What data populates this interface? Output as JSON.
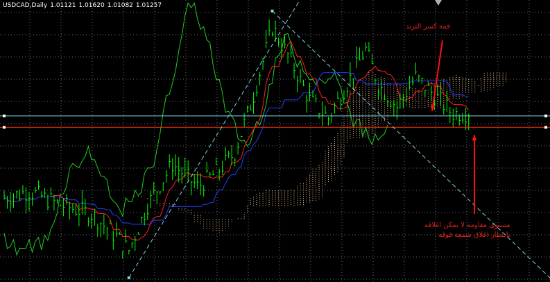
{
  "header": {
    "symbol": "USDCAD,Daily",
    "open": "1.01121",
    "high": "1.01620",
    "low": "1.01082",
    "close": "1.01257"
  },
  "annotations": {
    "trend_break": "قمة كسر الترند",
    "resistance_line1": "مستوى مقاومة لا يمكن اغلاقه",
    "resistance_line2": "بانتظار اغلاق شمعة فوقه"
  },
  "colors": {
    "background": "#000000",
    "grid": "#6b6b6b",
    "candles": "#00ff00",
    "chikou_span": "#22cc22",
    "tenkan_sen": "#ff2020",
    "kijun_sen": "#2040ff",
    "cloud": "#ffcc99",
    "trendline": "#7fd4e0",
    "horizontal_level": "#ff3300",
    "arrow": "#ff1010"
  },
  "chart_data": {
    "type": "candlestick",
    "symbol": "USDCAD",
    "timeframe": "Daily",
    "ohlc_last": {
      "open": 1.01121,
      "high": 1.0162,
      "low": 1.01082,
      "close": 1.01257
    },
    "indicators": [
      "ichimoku"
    ],
    "grid": true,
    "ylim": [
      0.94,
      1.06
    ],
    "x_count": 150,
    "price_path": [
      [
        0,
        0.975
      ],
      [
        8,
        0.978
      ],
      [
        18,
        0.972
      ],
      [
        28,
        0.968
      ],
      [
        36,
        0.958
      ],
      [
        40,
        0.952
      ],
      [
        46,
        0.972
      ],
      [
        54,
        0.99
      ],
      [
        62,
        0.98
      ],
      [
        68,
        0.986
      ],
      [
        74,
        0.995
      ],
      [
        80,
        1.02
      ],
      [
        86,
        1.05
      ],
      [
        92,
        1.035
      ],
      [
        98,
        1.018
      ],
      [
        104,
        1.01
      ],
      [
        110,
        1.025
      ],
      [
        116,
        1.04
      ],
      [
        120,
        1.025
      ],
      [
        126,
        1.015
      ],
      [
        132,
        1.028
      ],
      [
        138,
        1.02
      ],
      [
        144,
        1.012
      ],
      [
        148,
        1.0126
      ]
    ],
    "levels": [
      {
        "price": 1.006,
        "style": "horizontal",
        "color": "#ff3300"
      },
      {
        "price": 1.011,
        "style": "horizontal",
        "color": "#7fd4e0"
      }
    ],
    "trendlines": [
      {
        "from": [
          40,
          0.94
        ],
        "to": [
          150,
          1.04
        ]
      },
      {
        "from": [
          86,
          1.057
        ],
        "to": [
          180,
          1.018
        ]
      }
    ]
  }
}
